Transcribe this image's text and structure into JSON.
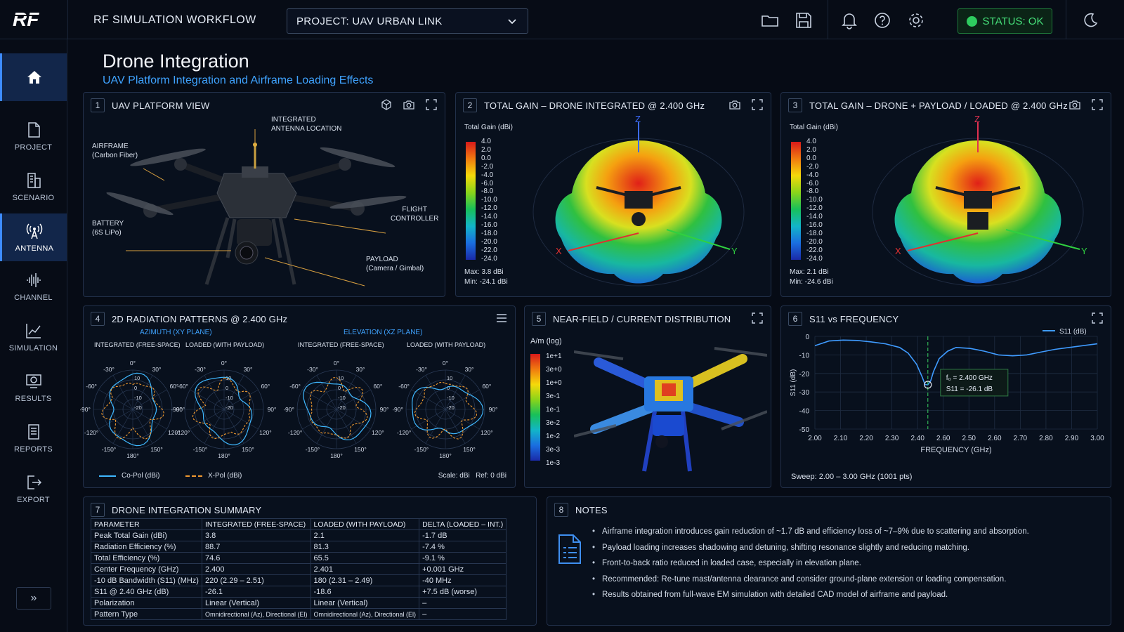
{
  "app": {
    "logo": "RF",
    "title": "RF SIMULATION WORKFLOW",
    "project_select": "PROJECT:  UAV URBAN LINK",
    "status": "STATUS: OK",
    "accent": "#3d8bff",
    "status_color": "#2ecc5f"
  },
  "toolbar_icons": [
    "folder-icon",
    "save-icon",
    "bell-icon",
    "help-icon",
    "gear-icon",
    "theme-moon-icon"
  ],
  "sidebar": {
    "items": [
      {
        "label": "",
        "icon": "home-icon"
      },
      {
        "label": "PROJECT",
        "icon": "document-icon"
      },
      {
        "label": "SCENARIO",
        "icon": "scenario-icon"
      },
      {
        "label": "ANTENNA",
        "icon": "antenna-icon"
      },
      {
        "label": "CHANNEL",
        "icon": "waveform-icon"
      },
      {
        "label": "SIMULATION",
        "icon": "chart-icon"
      },
      {
        "label": "RESULTS",
        "icon": "results-icon"
      },
      {
        "label": "REPORTS",
        "icon": "report-icon"
      },
      {
        "label": "EXPORT",
        "icon": "export-icon"
      }
    ],
    "collapse": "»"
  },
  "page": {
    "title": "Drone Integration",
    "subtitle": "UAV Platform Integration and Airframe Loading Effects"
  },
  "p1": {
    "num": "1",
    "title": "UAV PLATFORM VIEW",
    "callouts": {
      "antenna": "INTEGRATED\nANTENNA LOCATION",
      "airframe": "AIRFRAME\n(Carbon Fiber)",
      "battery": "BATTERY\n(6S LiPo)",
      "fc": "FLIGHT\nCONTROLLER",
      "payload": "PAYLOAD\n(Camera / Gimbal)"
    }
  },
  "p2": {
    "num": "2",
    "title": "TOTAL GAIN – DRONE INTEGRATED @ 2.400 GHz",
    "scale_label": "Total Gain (dBi)",
    "ticks": [
      "4.0",
      "2.0",
      "0.0",
      "-2.0",
      "-4.0",
      "-6.0",
      "-8.0",
      "-10.0",
      "-12.0",
      "-14.0",
      "-16.0",
      "-18.0",
      "-20.0",
      "-22.0",
      "-24.0"
    ],
    "max": "Max: 3.8 dBi",
    "min": "Min: -24.1 dBi",
    "axes": {
      "x": "X",
      "y": "Y",
      "z": "Z"
    }
  },
  "p3": {
    "num": "3",
    "title": "TOTAL GAIN – DRONE + PAYLOAD / LOADED @ 2.400 GHz",
    "scale_label": "Total Gain (dBi)",
    "ticks": [
      "4.0",
      "2.0",
      "0.0",
      "-2.0",
      "-4.0",
      "-6.0",
      "-8.0",
      "-10.0",
      "-12.0",
      "-14.0",
      "-16.0",
      "-18.0",
      "-20.0",
      "-22.0",
      "-24.0"
    ],
    "max": "Max: 2.1 dBi",
    "min": "Min: -24.6 dBi",
    "axes": {
      "x": "X",
      "y": "Y",
      "z": "Z"
    }
  },
  "p4": {
    "num": "4",
    "title": "2D RADIATION PATTERNS @ 2.400 GHz",
    "az_label": "AZIMUTH (XY PLANE)",
    "el_label": "ELEVATION (XZ PLANE)",
    "sub_int": "INTEGRATED (FREE-SPACE)",
    "sub_load": "LOADED (WITH PAYLOAD)",
    "angles": {
      "a0": "0°",
      "a30": "30°",
      "an30": "-30°",
      "a60": "60°",
      "an60": "-60°",
      "a90": "90°",
      "an90": "-90°",
      "a120": "120°",
      "an120": "-120°",
      "a150": "150°",
      "an150": "-150°",
      "a180": "180°"
    },
    "rings": [
      "10",
      "0",
      "-10",
      "-20"
    ],
    "legend_co": "Co-Pol (dBi)",
    "legend_x": "X-Pol (dBi)",
    "scale": "Scale: dBi   Ref: 0 dBi",
    "copol_color": "#3fb8ff",
    "xpol_color": "#f09a30"
  },
  "p5": {
    "num": "5",
    "title": "NEAR-FIELD / CURRENT DISTRIBUTION",
    "unit": "A/m (log)",
    "ticks": [
      "1e+1",
      "3e+0",
      "1e+0",
      "3e-1",
      "1e-1",
      "3e-2",
      "1e-2",
      "3e-3",
      "1e-3"
    ]
  },
  "p6": {
    "num": "6",
    "title": "S11 vs FREQUENCY",
    "legend": "S11 (dB)",
    "tooltip_f": "f₀ = 2.400 GHz",
    "tooltip_s": "S11 = -26.1 dB",
    "sweep": "Sweep: 2.00 – 3.00 GHz (1001 pts)"
  },
  "p7": {
    "num": "7",
    "title": "DRONE INTEGRATION SUMMARY",
    "headers": [
      "PARAMETER",
      "INTEGRATED (FREE-SPACE)",
      "LOADED (WITH PAYLOAD)",
      "DELTA (LOADED – INT.)"
    ],
    "rows": [
      [
        "Peak Total Gain (dBi)",
        "3.8",
        "2.1",
        "-1.7 dB"
      ],
      [
        "Radiation Efficiency (%)",
        "88.7",
        "81.3",
        "-7.4 %"
      ],
      [
        "Total Efficiency (%)",
        "74.6",
        "65.5",
        "-9.1 %"
      ],
      [
        "Center Frequency (GHz)",
        "2.400",
        "2.401",
        "+0.001 GHz"
      ],
      [
        "-10 dB Bandwidth (S11) (MHz)",
        "220 (2.29 – 2.51)",
        "180 (2.31 – 2.49)",
        "-40 MHz"
      ],
      [
        "S11 @ 2.40 GHz (dB)",
        "-26.1",
        "-18.6",
        "+7.5 dB (worse)"
      ],
      [
        "Polarization",
        "Linear (Vertical)",
        "Linear (Vertical)",
        "–"
      ],
      [
        "Pattern Type",
        "Omnidirectional (Az), Directional (El)",
        "Omnidirectional (Az), Directional (El)",
        "–"
      ]
    ]
  },
  "p8": {
    "num": "8",
    "title": "NOTES",
    "items": [
      "Airframe integration introduces gain reduction of ~1.7 dB and efficiency loss of ~7–9% due to scattering and absorption.",
      "Payload loading increases shadowing and detuning, shifting resonance slightly and reducing matching.",
      "Front-to-back ratio reduced in loaded case, especially in elevation plane.",
      "Recommended: Re-tune mast/antenna clearance and consider ground-plane extension or loading compensation.",
      "Results obtained from full-wave EM simulation with detailed CAD model of airframe and payload."
    ]
  },
  "chart_data": {
    "type": "line",
    "title": "S11 vs FREQUENCY",
    "xlabel": "FREQUENCY (GHz)",
    "ylabel": "S11 (dB)",
    "x_tick_labels": [
      "2.00",
      "2.10",
      "2.20",
      "2.30",
      "2.40",
      "2.60",
      "2.50",
      "2.60",
      "2.70",
      "2.80",
      "2.90",
      "3.00"
    ],
    "y_ticks": [
      0,
      -10,
      -20,
      -30,
      -40,
      -50
    ],
    "ylim": [
      -50,
      0
    ],
    "xlim": [
      2.0,
      3.0
    ],
    "grid": true,
    "legend": "top-right",
    "series": [
      {
        "name": "S11 (dB)",
        "color": "#3f9bff",
        "x": [
          2.0,
          2.02,
          2.05,
          2.1,
          2.15,
          2.2,
          2.25,
          2.3,
          2.33,
          2.36,
          2.38,
          2.39,
          2.4,
          2.41,
          2.42,
          2.44,
          2.47,
          2.5,
          2.55,
          2.6,
          2.65,
          2.7,
          2.75,
          2.8,
          2.85,
          2.9,
          2.95,
          3.0
        ],
        "values": [
          -5,
          -4,
          -2.5,
          -2,
          -2.2,
          -3,
          -4,
          -6,
          -9,
          -15,
          -22,
          -26,
          -26.1,
          -24,
          -19,
          -12,
          -8,
          -6,
          -6.5,
          -8,
          -10,
          -10.5,
          -10,
          -8.5,
          -7,
          -6,
          -5,
          -4
        ]
      }
    ],
    "marker": {
      "x": 2.4,
      "y": -26.1
    }
  }
}
